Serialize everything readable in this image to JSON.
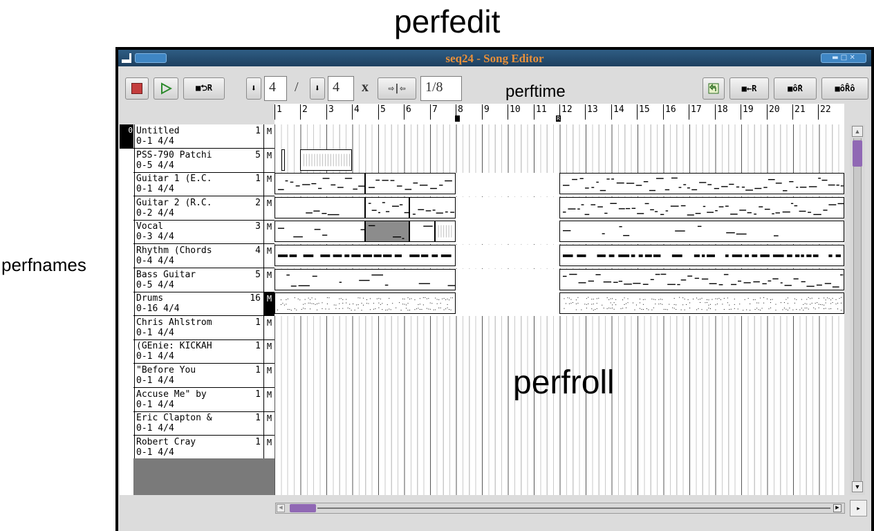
{
  "annotations": {
    "perfedit": "perfedit",
    "perftime": "perftime",
    "perfnames": "perfnames",
    "perfroll": "perfroll"
  },
  "window": {
    "title": "seq24 - Song Editor"
  },
  "toolbar": {
    "stop_icon": "stop-icon",
    "play_icon": "play-icon",
    "loop_label": "■⮌R",
    "bpm_value": "4",
    "slash": "/",
    "bw_value": "4",
    "x_label": "x",
    "collapse_expand_icon": "⇨|⇦",
    "snap_value": "1/8",
    "undo_icon": "undo-icon",
    "l_to_r_label": "■←R",
    "collapse_label": "■ô̂R",
    "expand_label": "■ôR̂ô"
  },
  "ruler": {
    "measures": [
      "1",
      "2",
      "3",
      "4",
      "5",
      "6",
      "7",
      "8",
      "9",
      "10",
      "11",
      "12",
      "13",
      "14",
      "15",
      "16",
      "17",
      "18",
      "19",
      "20",
      "21",
      "22"
    ],
    "left_marker": "L",
    "right_marker": "R"
  },
  "tracks": [
    {
      "num": "0",
      "name": "Untitled",
      "channel": "1",
      "info": "0-1 4/4",
      "mute": "M"
    },
    {
      "num": "",
      "name": "PSS-790 Patchi",
      "channel": "5",
      "info": "0-5 4/4",
      "mute": "M"
    },
    {
      "num": "",
      "name": "Guitar 1 (E.C.",
      "channel": "1",
      "info": "0-1 4/4",
      "mute": "M"
    },
    {
      "num": "",
      "name": "Guitar 2 (R.C.",
      "channel": "2",
      "info": "0-2 4/4",
      "mute": "M"
    },
    {
      "num": "",
      "name": "Vocal",
      "channel": "3",
      "info": "0-3 4/4",
      "mute": "M"
    },
    {
      "num": "",
      "name": "Rhythm (Chords",
      "channel": "4",
      "info": "0-4 4/4",
      "mute": "M"
    },
    {
      "num": "",
      "name": "Bass Guitar",
      "channel": "5",
      "info": "0-5 4/4",
      "mute": "M"
    },
    {
      "num": "",
      "name": "Drums",
      "channel": "16",
      "info": "0-16 4/4",
      "mute": "M"
    },
    {
      "num": "",
      "name": "Chris Ahlstrom",
      "channel": "1",
      "info": "0-1 4/4",
      "mute": "M"
    },
    {
      "num": "",
      "name": "(GEnie: KICKAH",
      "channel": "1",
      "info": "0-1 4/4",
      "mute": "M"
    },
    {
      "num": "",
      "name": "\"Before You",
      "channel": "1",
      "info": "0-1 4/4",
      "mute": "M"
    },
    {
      "num": "",
      "name": "Accuse Me\" by",
      "channel": "1",
      "info": "0-1 4/4",
      "mute": "M"
    },
    {
      "num": "",
      "name": "Eric Clapton &",
      "channel": "1",
      "info": "0-1 4/4",
      "mute": "M"
    },
    {
      "num": "",
      "name": "Robert Cray",
      "channel": "1",
      "info": "0-1 4/4",
      "mute": "M"
    }
  ],
  "colors": {
    "title_bg": "#244a6e",
    "title_text": "#e8903a",
    "scroll_thumb": "#9068b4",
    "selected_block": "#8c8c8c"
  }
}
